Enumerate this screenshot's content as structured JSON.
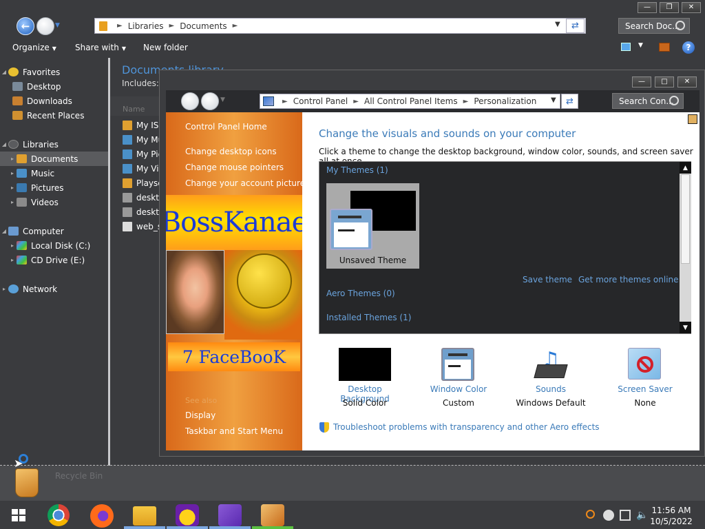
{
  "explorer": {
    "address": {
      "crumbs": [
        "Libraries",
        "Documents"
      ]
    },
    "search_placeholder": "Search Doc...",
    "toolbar": {
      "organize": "Organize",
      "share_with": "Share with",
      "new_folder": "New folder"
    },
    "nav": {
      "favorites": "Favorites",
      "desktop": "Desktop",
      "downloads": "Downloads",
      "recent_places": "Recent Places",
      "libraries": "Libraries",
      "documents": "Documents",
      "music": "Music",
      "pictures": "Pictures",
      "videos": "Videos",
      "computer": "Computer",
      "local_disk": "Local Disk (C:)",
      "cd_drive": "CD Drive (E:)",
      "network": "Network"
    },
    "library_title": "Documents library",
    "includes": "Includes:",
    "column_name": "Name",
    "files": [
      "My ISC",
      "My Mu",
      "My Pic",
      "My Vic",
      "Playse",
      "deskto",
      "deskto",
      "web_se"
    ]
  },
  "control_panel": {
    "address": {
      "crumbs": [
        "Control Panel",
        "All Control Panel Items",
        "Personalization"
      ]
    },
    "search_placeholder": "Search Con...",
    "side": {
      "home": "Control Panel Home",
      "desktop_icons": "Change desktop icons",
      "mouse_pointers": "Change mouse pointers",
      "account_picture": "Change your account picture",
      "banner_top": "BossKanae",
      "banner_bottom": "7 FaceBooK",
      "see_also": "See also",
      "display": "Display",
      "taskbar": "Taskbar and Start Menu"
    },
    "heading": "Change the visuals and sounds on your computer",
    "subheading": "Click a theme to change the desktop background, window color, sounds, and screen saver all at once.",
    "themes": {
      "my_themes": "My Themes (1)",
      "tile_label": "Unsaved Theme",
      "save_theme": "Save theme",
      "get_more": "Get more themes online",
      "aero": "Aero Themes (0)",
      "installed": "Installed Themes (1)"
    },
    "bottom": {
      "bg_label": "Desktop Background",
      "bg_value": "Solid Color",
      "wc_label": "Window Color",
      "wc_value": "Custom",
      "snd_label": "Sounds",
      "snd_value": "Windows Default",
      "ss_label": "Screen Saver",
      "ss_value": "None"
    },
    "troubleshoot": "Troubleshoot problems with transparency and other Aero effects"
  },
  "desktop": {
    "label": "Recycle Bin"
  },
  "taskbar": {
    "apps": [
      "start-icon",
      "chrome-icon",
      "firefox-icon",
      "file-explorer-icon",
      "yahoo-messenger-icon",
      "visual-studio-icon",
      "media-player-icon"
    ],
    "time": "11:56 AM",
    "date": "10/5/2022"
  },
  "colors": {
    "link": "#3a7ab8",
    "accent_orange": "#e07a20",
    "taskbar_active": "#7aa6e0"
  }
}
